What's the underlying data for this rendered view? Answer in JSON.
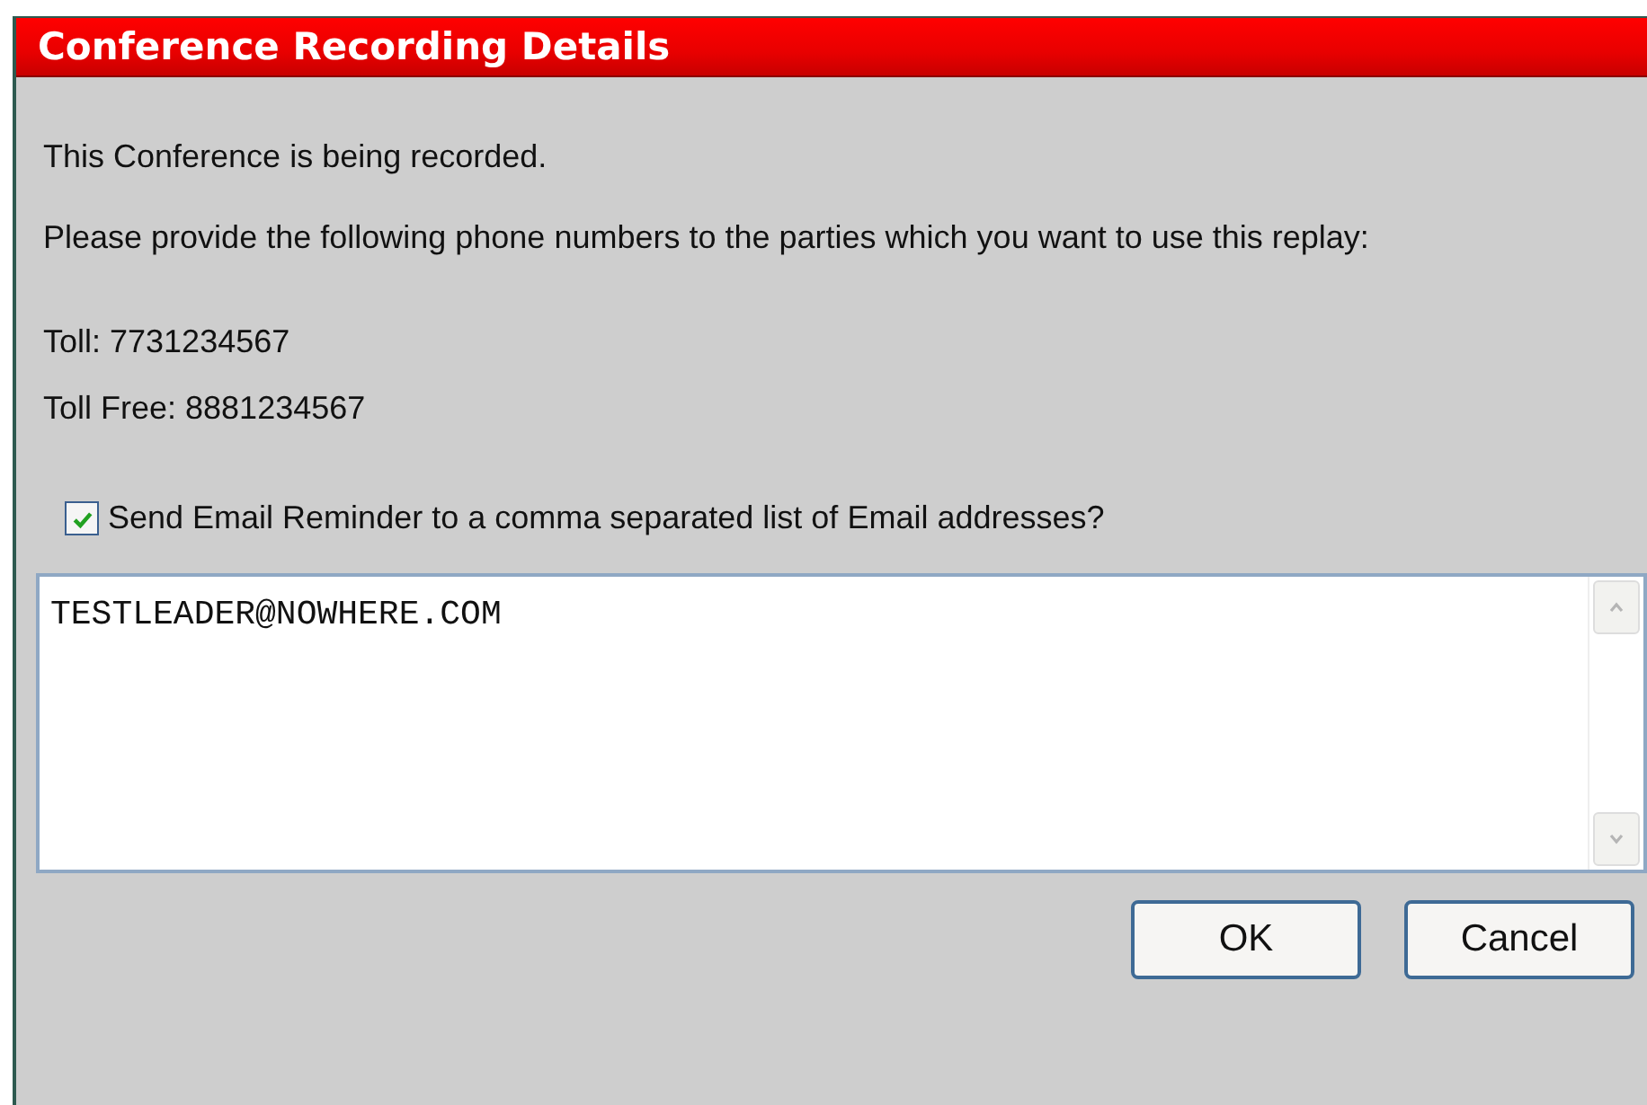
{
  "dialog": {
    "title": "Conference Recording Details"
  },
  "paragraphs": [
    "This Conference is being recorded.",
    "Please provide the following phone numbers to the parties which you want to use this replay:"
  ],
  "numbers": [
    "Toll: 7731234567",
    "Toll Free: 8881234567"
  ],
  "email_reminder": {
    "label": "Send Email Reminder to a comma separated list of Email addresses?",
    "checked": true
  },
  "email_field": {
    "value": "TESTLEADER@NOWHERE.COM"
  },
  "buttons": [
    "OK",
    "Cancel"
  ]
}
